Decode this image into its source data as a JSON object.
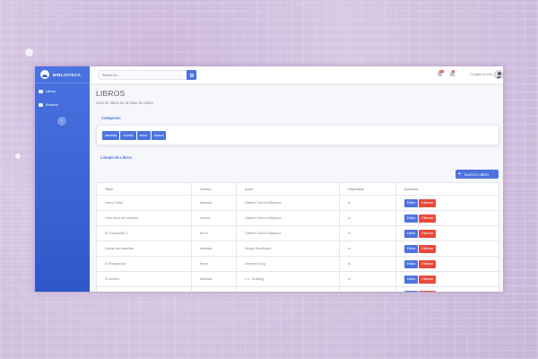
{
  "sidebar": {
    "brand": "BIBLIOTECA",
    "items": [
      {
        "label": "Libros"
      },
      {
        "label": "Autores"
      }
    ],
    "toggle": "‹"
  },
  "topbar": {
    "search_placeholder": "Search for...",
    "alerts_count": "3+",
    "messages_count": "7",
    "user_name": "Douglas McGee"
  },
  "page": {
    "title": "LIBROS",
    "subtitle": "Lista de libros de la base de datos."
  },
  "categories": {
    "title": "Categorias",
    "items": [
      "fantasia",
      "novela",
      "terror",
      "drama"
    ]
  },
  "listing": {
    "title": "Listado de Libros",
    "new_button": "NUEVO LIBRO",
    "columns": [
      "Titulo",
      "Genero",
      "Autor",
      "Disponible",
      "Acciones"
    ],
    "edit_label": "Editar",
    "delete_label": "Eliminar",
    "rows": [
      {
        "titulo": "Harry Potter",
        "genero": "fantasia",
        "autor": "Gabriel García Márquez",
        "disponible": "si"
      },
      {
        "titulo": "Cien años de soledad",
        "genero": "novela",
        "autor": "Gabriel García Márquez",
        "disponible": "si"
      },
      {
        "titulo": "El resplandor 2",
        "genero": "terror",
        "autor": "Gabriel García Márquez",
        "disponible": "si"
      },
      {
        "titulo": "Desde las estrellas",
        "genero": "fantasia",
        "autor": "Sergio Bambarén",
        "disponible": "si"
      },
      {
        "titulo": "El Resplandor",
        "genero": "terror",
        "autor": "Stephen King",
        "disponible": "si"
      },
      {
        "titulo": "El sinistro",
        "genero": "fantasia",
        "autor": "L.K. Rowling",
        "disponible": "si"
      },
      {
        "titulo": "Zapatero",
        "genero": "drama",
        "autor": "L.K. Rowling",
        "disponible": "si"
      }
    ]
  },
  "colors": {
    "primary": "#4e73df",
    "danger": "#e74a3b",
    "sidebar_top": "#4a72e0",
    "sidebar_bottom": "#2e57c9"
  }
}
